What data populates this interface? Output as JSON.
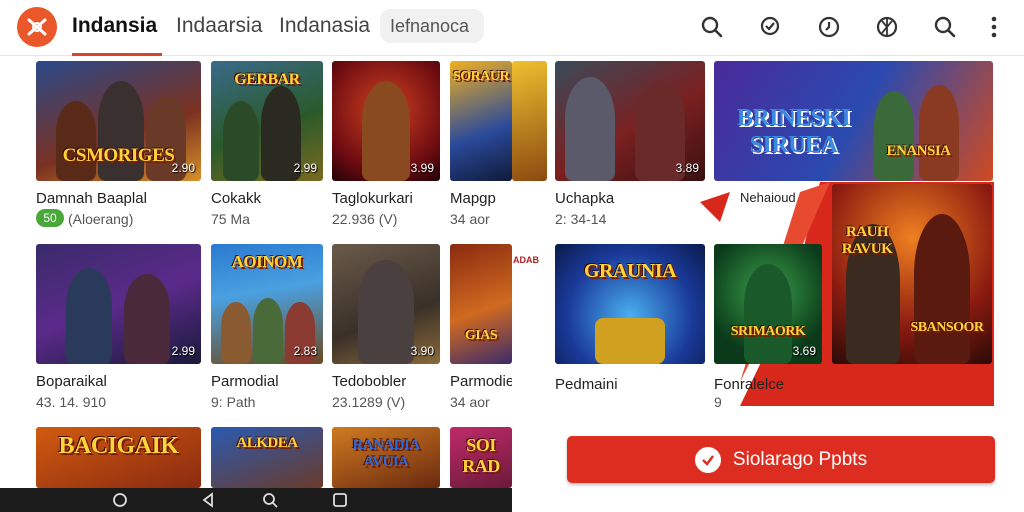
{
  "header": {
    "tabs": [
      "Indansia",
      "Indaarsia",
      "Indanasia"
    ],
    "chip": "Iefnanoca",
    "icons": [
      "search-icon",
      "chat-check-icon",
      "clock-icon",
      "globe-icon",
      "search-icon",
      "more-vertical-icon"
    ]
  },
  "apps_left": [
    {
      "tile_text": "CSMORIGES",
      "price": "2.90",
      "name": "Damnah Baaplal",
      "sub": "(Aloerang)",
      "badge": "50"
    },
    {
      "tile_text": "GERBAR",
      "price": "2.99",
      "name": "Cokakk",
      "sub": "75 Ma"
    },
    {
      "tile_text": "",
      "price": "3.99",
      "name": "Taglokurkari",
      "sub": "22.936 (V)"
    },
    {
      "tile_text": "SORAUR",
      "price": "",
      "name": "Mapgp",
      "sub": "34 aor"
    },
    {
      "tile_text": "",
      "price": "2.99",
      "name": "Boparaikal",
      "sub": "43. 14. 910"
    },
    {
      "tile_text": "AOINOM",
      "price": "2.83",
      "name": "Parmodial",
      "sub": "9: Path"
    },
    {
      "tile_text": "",
      "price": "3.90",
      "name": "Tedobobler",
      "sub": "23.1289 (V)"
    },
    {
      "tile_text": "GIAS",
      "price": "",
      "name": "Parmodie",
      "sub": "34 aor"
    },
    {
      "tile_text": "BACIGAIK",
      "price": "",
      "name": "",
      "sub": ""
    },
    {
      "tile_text": "ALKDEA",
      "price": "",
      "name": "",
      "sub": ""
    },
    {
      "tile_text": "RANADIA AVUIA",
      "price": "",
      "name": "",
      "sub": ""
    },
    {
      "tile_text": "SOI RAD",
      "price": "",
      "name": "",
      "sub": ""
    }
  ],
  "apps_right": [
    {
      "tile_text": "",
      "price": "3.89",
      "name": "Uchapka",
      "sub": "2: 34-14"
    },
    {
      "tile_text": "BRINESKI SIRUEA",
      "name": "Nehaioud",
      "sub": ""
    },
    {
      "tile_text": "ENANSIA",
      "name": "",
      "sub": ""
    },
    {
      "tile_text": "GRAUNIA",
      "price": "",
      "name": "Pedmaini",
      "sub": ""
    },
    {
      "tile_text": "SRIMAORK",
      "price": "3.69",
      "name": "Fonralelce",
      "sub": "9"
    },
    {
      "tile_text": "SBANSOOR",
      "name": "",
      "sub": ""
    },
    {
      "tile_text": "RAUH RAVUK",
      "name": "",
      "sub": ""
    }
  ],
  "small_logo_text": "ADAB",
  "cta": {
    "label": "Siolarago Ppbts"
  },
  "nav": [
    "home-icon",
    "back-icon",
    "search-icon",
    "recents-icon"
  ],
  "colors": {
    "accent": "#d8452b",
    "cta": "#dc2d20",
    "logo": "#e9572b"
  }
}
